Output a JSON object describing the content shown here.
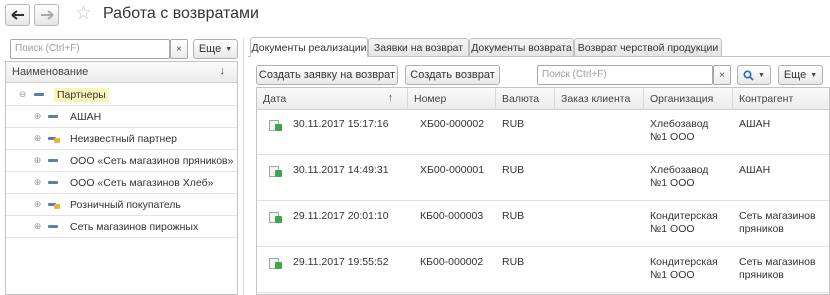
{
  "window": {
    "title": "Работа с возвратами"
  },
  "left": {
    "search_placeholder": "Поиск (Ctrl+F)",
    "clear_label": "×",
    "more_label": "Еще",
    "tree_header": "Наименование",
    "sort_glyph": "↓",
    "rows": [
      {
        "label": "Партнеры",
        "expander": "⊖",
        "kind": "root"
      },
      {
        "label": "АШАН",
        "expander": "⊕",
        "kind": "folder"
      },
      {
        "label": "Неизвестный партнер",
        "expander": "⊕",
        "kind": "item"
      },
      {
        "label": "ООО «Сеть магазинов пряников»",
        "expander": "⊕",
        "kind": "folder"
      },
      {
        "label": "ООО «Сеть магазинов Хлеб»",
        "expander": "⊕",
        "kind": "folder"
      },
      {
        "label": "Розничный покупатель",
        "expander": "⊕",
        "kind": "item"
      },
      {
        "label": "Сеть магазинов пирожных",
        "expander": "⊕",
        "kind": "folder"
      }
    ]
  },
  "tabs": [
    {
      "label": "Документы реализации",
      "active": true
    },
    {
      "label": "Заявки на возврат",
      "active": false
    },
    {
      "label": "Документы возврата",
      "active": false
    },
    {
      "label": "Возврат черствой продукции",
      "active": false
    }
  ],
  "toolbar": {
    "create_request_label": "Создать заявку на возврат",
    "create_return_label": "Создать возврат",
    "search_placeholder": "Поиск (Ctrl+F)",
    "clear_label": "×",
    "search_icon": "magnifier-icon",
    "more_label": "Еще"
  },
  "table": {
    "columns": [
      "Дата",
      "Номер",
      "Валюта",
      "Заказ клиента",
      "Организация",
      "Контрагент"
    ],
    "sort_glyph": "↑",
    "rows": [
      {
        "date": "30.11.2017 15:17:16",
        "number": "ХБ00-000002",
        "currency": "RUB",
        "order": "",
        "org1": "Хлебозавод",
        "org2": "№1 ООО",
        "contr1": "АШАН",
        "contr2": ""
      },
      {
        "date": "30.11.2017 14:49:31",
        "number": "ХБ00-000001",
        "currency": "RUB",
        "order": "",
        "org1": "Хлебозавод",
        "org2": "№1 ООО",
        "contr1": "АШАН",
        "contr2": ""
      },
      {
        "date": "29.11.2017 20:01:10",
        "number": "КБ00-000003",
        "currency": "RUB",
        "order": "",
        "org1": "Кондитерская",
        "org2": "№1 ООО",
        "contr1": "Сеть магазинов",
        "contr2": "пряников"
      },
      {
        "date": "29.11.2017 19:55:52",
        "number": "КБ00-000002",
        "currency": "RUB",
        "order": "",
        "org1": "Кондитерская",
        "org2": "№1 ООО",
        "contr1": "Сеть магазинов",
        "contr2": "пряников"
      }
    ]
  },
  "colors": {
    "accent": "#5a7fa8",
    "highlight": "#fbf4b8",
    "doc_arrow": "#3ea64a",
    "search_icon": "#2a6fb0"
  }
}
